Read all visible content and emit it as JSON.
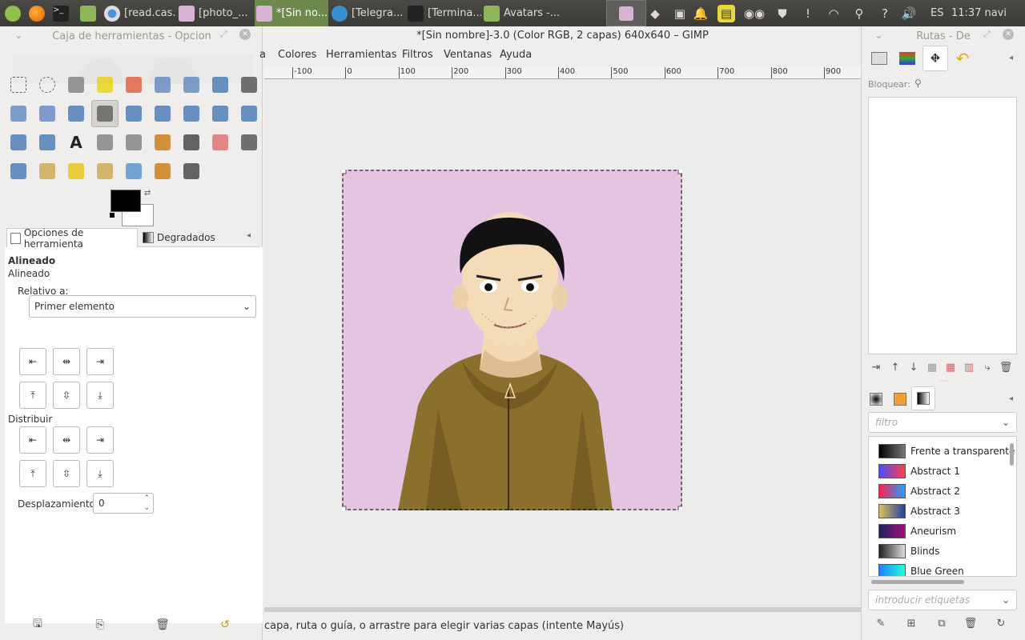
{
  "taskbar": {
    "items": [
      {
        "label": ""
      },
      {
        "label": ""
      },
      {
        "label": ""
      },
      {
        "label": ""
      },
      {
        "label": "[read.cas..."
      },
      {
        "label": "[photo_..."
      },
      {
        "label": "*[Sin no..."
      },
      {
        "label": "[Telegra..."
      },
      {
        "label": "[Termina..."
      },
      {
        "label": "Avatars -..."
      }
    ],
    "keyboard": "ES",
    "clock": "11:37",
    "user": "navi"
  },
  "window": {
    "title": "*[Sin nombre]-3.0 (Color RGB, 2 capas) 640x640 – GIMP"
  },
  "menu": [
    "a",
    "Colores",
    "Herramientas",
    "Filtros",
    "Ventanas",
    "Ayuda"
  ],
  "toolbox": {
    "title": "Caja de herramientas - Opcion",
    "tabs": [
      {
        "label": "Opciones de herramienta"
      },
      {
        "label": "Degradados"
      }
    ],
    "section_title": "Alineado",
    "subtitle": "Alineado",
    "relative_label": "Relativo a:",
    "relative_value": "Primer elemento",
    "distribute_label": "Distribuir",
    "offset_label": "Desplazamiento:",
    "offset_value": "0"
  },
  "ruler": [
    "-100",
    "0",
    "100",
    "200",
    "300",
    "400",
    "500",
    "600",
    "700",
    "800",
    "900"
  ],
  "status": "capa, ruta o guía, o arrastre para elegir varias capas (intente Mayús)",
  "paths_dock": {
    "title": "Rutas - De",
    "lock_label": "Bloquear:",
    "filter_placeholder": "filtro",
    "tags_placeholder": "introducir etiquetas"
  },
  "gradients": [
    {
      "name": "Frente a transparente",
      "colors": [
        "#000000",
        "#777777"
      ]
    },
    {
      "name": "Abstract 1",
      "colors": [
        "#4b4bff",
        "#ff4040"
      ]
    },
    {
      "name": "Abstract 2",
      "colors": [
        "#ff2050",
        "#20a0ff"
      ]
    },
    {
      "name": "Abstract 3",
      "colors": [
        "#e0c060",
        "#2040a0"
      ]
    },
    {
      "name": "Aneurism",
      "colors": [
        "#202060",
        "#a01080"
      ]
    },
    {
      "name": "Blinds",
      "colors": [
        "#222222",
        "#dddddd"
      ]
    },
    {
      "name": "Blue Green",
      "colors": [
        "#2080ff",
        "#20ffd0"
      ]
    }
  ],
  "colors": {
    "accent": "#6d8a4c",
    "canvas": "#e4c4e1",
    "hoodie": "#8b6f2c"
  }
}
